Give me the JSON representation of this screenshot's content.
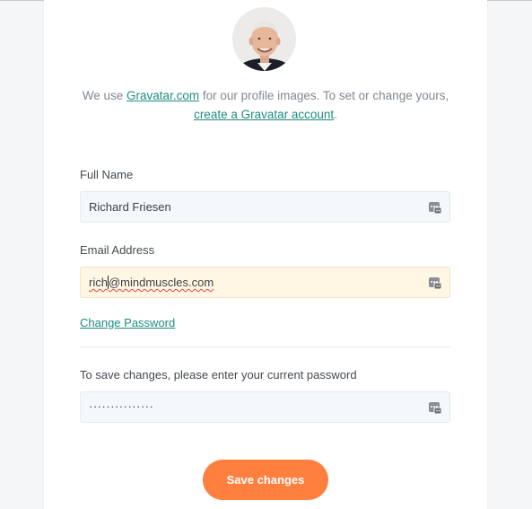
{
  "profile": {
    "gravatar_note_before": "We use ",
    "gravatar_link": "Gravatar.com",
    "gravatar_note_middle": " for our profile images. To set or change yours, ",
    "create_account_link": "create a Gravatar account",
    "gravatar_note_end": "."
  },
  "form": {
    "full_name_label": "Full Name",
    "full_name_value": "Richard Friesen",
    "email_label": "Email Address",
    "email_value_before_caret": "rich",
    "email_value_after_caret": "@mindmuscles.com",
    "change_password_link": "Change Password",
    "current_password_prompt": "To save changes, please enter your current password",
    "current_password_masked": "···············",
    "save_button": "Save changes"
  },
  "icons": {
    "password_manager": "password-manager-icon"
  },
  "colors": {
    "accent": "#ff7f3f",
    "link": "#1f8b80",
    "focused_field_bg": "#fff7e4",
    "field_bg": "#f4f8fa"
  }
}
